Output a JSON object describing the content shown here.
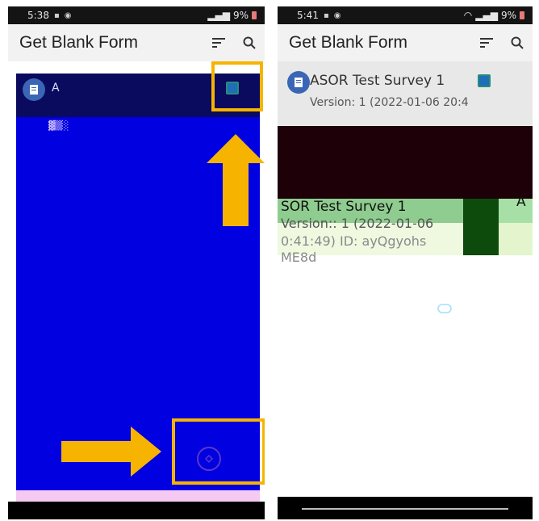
{
  "left": {
    "status": {
      "time": "5:38",
      "battery": "9%"
    },
    "appbar": {
      "title": "Get Blank Form"
    },
    "row": {
      "name": "A"
    }
  },
  "right": {
    "status": {
      "time": "5:41",
      "battery": "9%"
    },
    "appbar": {
      "title": "Get Blank Form"
    },
    "row1": {
      "name": "ASOR Test Survey 1",
      "meta": "Version: 1 (2022-01-06 20:4"
    },
    "row2": {
      "name": "SOR Test Survey 1",
      "version": "Version:: 1 (2022-01-06",
      "id_line": "0:41:49) ID: ayQgyohs",
      "id_line2": "ME8d",
      "side_char": "A"
    }
  },
  "colors": {
    "highlight": "#f6b400",
    "left_background": "#0000e0",
    "checkbox": "#1f6fb8"
  },
  "icons": [
    "sort-icon",
    "search-icon",
    "form-icon",
    "checkbox-icon",
    "fab-icon",
    "arrow-up-icon",
    "arrow-right-icon"
  ]
}
